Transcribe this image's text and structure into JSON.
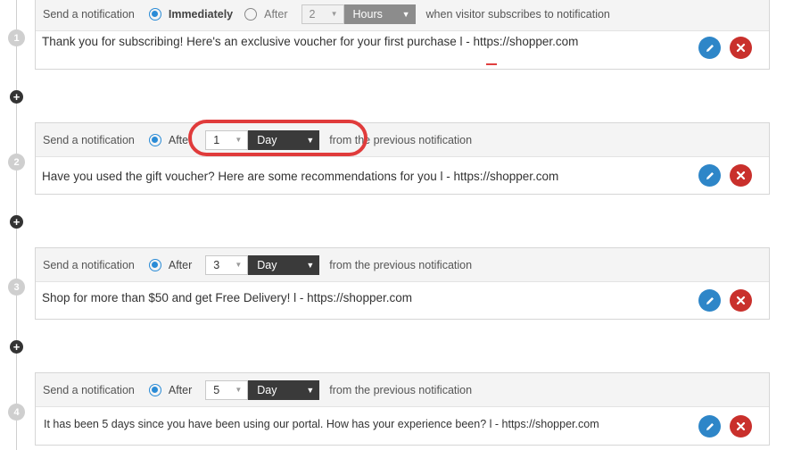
{
  "steps": [
    {
      "number": "1",
      "label": "Send a notification",
      "option_immediately": "Immediately",
      "option_after": "After",
      "amount": "2",
      "unit": "Hours",
      "suffix": "when visitor subscribes to notification",
      "message": "Thank you for subscribing! Here's an exclusive voucher for your first purchase l - https://shopper.com"
    },
    {
      "number": "2",
      "label": "Send a notification",
      "option_after": "After",
      "amount": "1",
      "unit": "Day",
      "suffix": "from the previous notification",
      "message": "Have you used the gift voucher? Here are some recommendations for you l - https://shopper.com"
    },
    {
      "number": "3",
      "label": "Send a notification",
      "option_after": "After",
      "amount": "3",
      "unit": "Day",
      "suffix": "from the previous notification",
      "message": "Shop for more than $50 and get Free Delivery! l - https://shopper.com"
    },
    {
      "number": "4",
      "label": "Send a notification",
      "option_after": "After",
      "amount": "5",
      "unit": "Day",
      "suffix": "from the previous notification",
      "message": "It has been 5 days since you have been using our portal. How has your experience been? l - https://shopper.com"
    }
  ],
  "add_symbol": "+",
  "colors": {
    "accent_blue": "#2a8bd6",
    "edit_button": "#2e86c8",
    "delete_button": "#c9302c",
    "unit_select_dark": "#3a3a3a",
    "highlight": "#e03b3b"
  },
  "icons": {
    "edit": "pencil-icon",
    "delete": "close-icon",
    "add": "plus-icon"
  }
}
